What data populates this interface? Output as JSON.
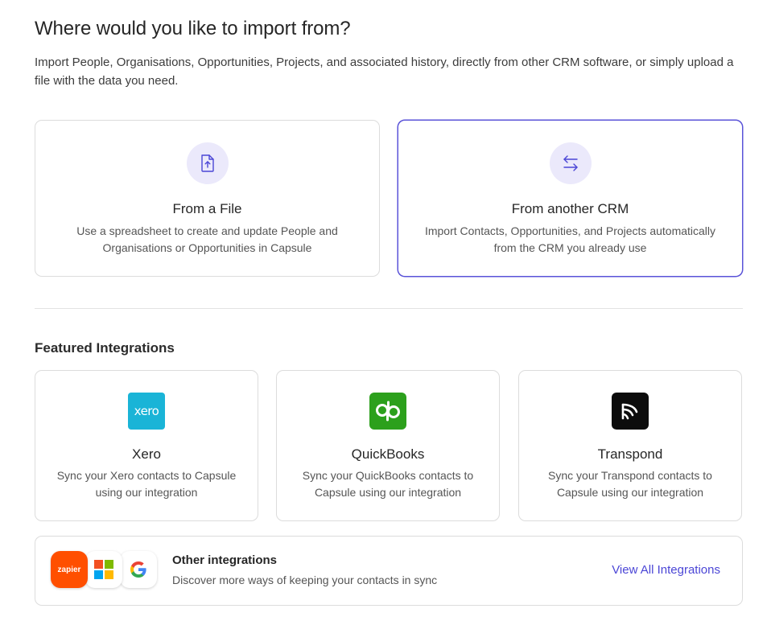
{
  "page": {
    "title": "Where would you like to import from?",
    "intro": "Import People, Organisations, Opportunities, Projects, and associated history, directly from other CRM software, or simply upload a file with the data you need."
  },
  "import_options": [
    {
      "title": "From a File",
      "description": "Use a spreadsheet to create and update People and Organisations or Opportunities in Capsule",
      "icon": "file-upload-icon",
      "selected": false
    },
    {
      "title": "From another CRM",
      "description": "Import Contacts, Opportunities, and Projects automatically from the CRM you already use",
      "icon": "swap-arrows-icon",
      "selected": true
    }
  ],
  "featured": {
    "heading": "Featured Integrations",
    "items": [
      {
        "title": "Xero",
        "description": "Sync your Xero contacts to Capsule using our integration",
        "logo_text": "xero",
        "logo_color": "#1ab4d7"
      },
      {
        "title": "QuickBooks",
        "description": "Sync your QuickBooks contacts to Capsule using our integration",
        "logo_text": "qb",
        "logo_color": "#2ca01c"
      },
      {
        "title": "Transpond",
        "description": "Sync your Transpond contacts to Capsule using our integration",
        "logo_text": "",
        "logo_color": "#0c0c0c"
      }
    ]
  },
  "other": {
    "title": "Other integrations",
    "description": "Discover more ways of keeping your contacts in sync",
    "link": "View All Integrations",
    "badges": [
      {
        "name": "zapier-logo",
        "text": "zapier",
        "color": "#ff4f00"
      },
      {
        "name": "microsoft-logo",
        "text": ""
      },
      {
        "name": "google-logo",
        "text": ""
      }
    ]
  },
  "colors": {
    "accent": "#5a53d8",
    "link": "#4b46d6",
    "icon_bg": "#ebe9fb"
  }
}
